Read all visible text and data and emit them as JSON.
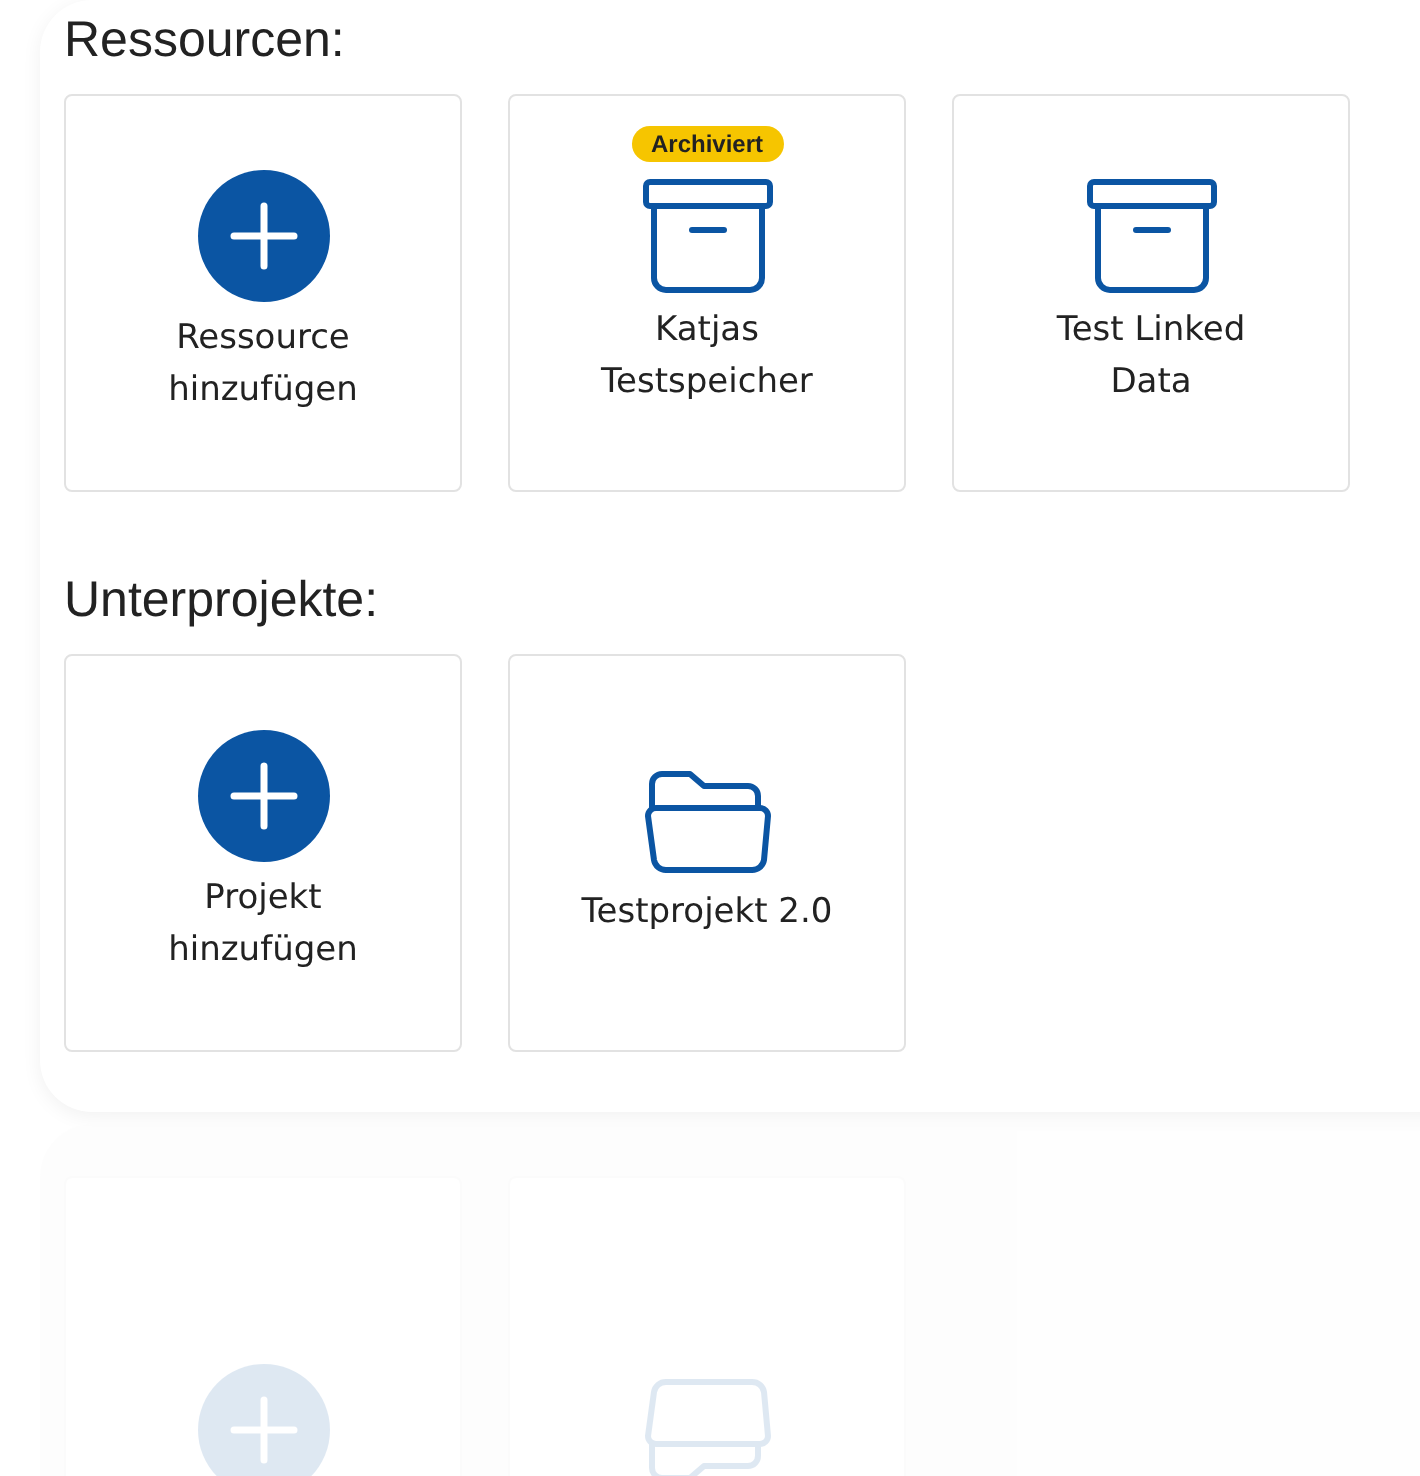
{
  "sections": [
    {
      "title": "Ressourcen:",
      "tiles": [
        {
          "kind": "add",
          "label": "Ressource\nhinzufügen"
        },
        {
          "kind": "archive",
          "label": "Katjas\nTestspeicher",
          "badge": "Archiviert"
        },
        {
          "kind": "archive",
          "label": "Test Linked\nData"
        }
      ]
    },
    {
      "title": "Unterprojekte:",
      "tiles": [
        {
          "kind": "add",
          "label": "Projekt\nhinzufügen"
        },
        {
          "kind": "folder",
          "label": "Testprojekt 2.0"
        }
      ]
    }
  ]
}
